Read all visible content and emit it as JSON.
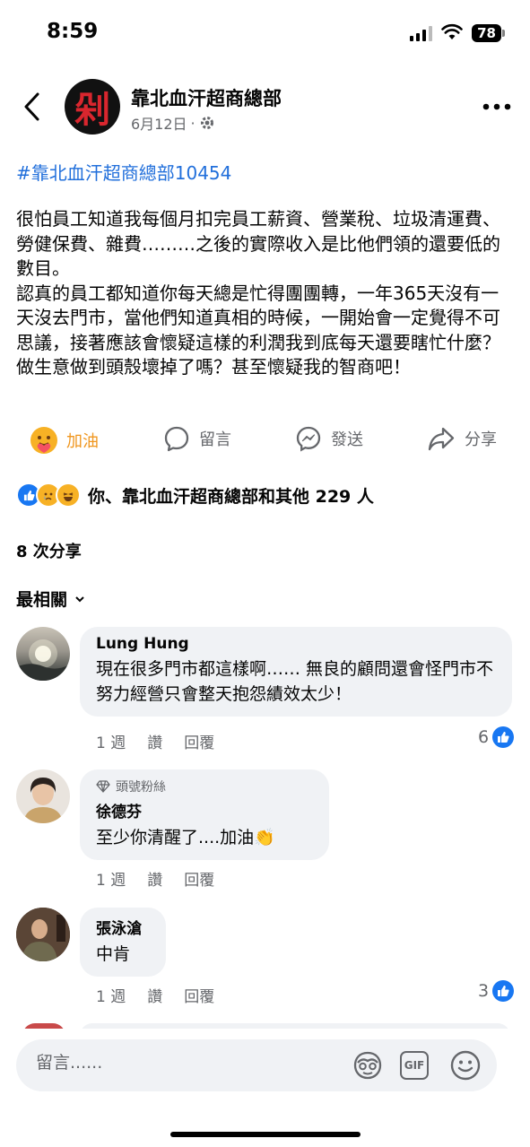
{
  "status_bar": {
    "time": "8:59",
    "battery": "78"
  },
  "post": {
    "page_name": "靠北血汗超商總部",
    "page_avatar_text": "剁",
    "date": "6月12日",
    "meta_sep": "·",
    "hashtag": "#靠北血汗超商總部10454",
    "body": "很怕員工知道我每個月扣完員工薪資、營業稅、垃圾清運費、勞健保費、雜費………之後的實際收入是比他們領的還要低的數目。\n認真的員工都知道你每天總是忙得團團轉，一年365天沒有一天沒去門市，當他們知道真相的時候，一開始會一定覺得不可思議，接著應該會懷疑這樣的利潤我到底每天還要瞎忙什麼？做生意做到頭殼壞掉了嗎？甚至懷疑我的智商吧！"
  },
  "actions": {
    "care": "加油",
    "comment": "留言",
    "send": "發送",
    "share": "分享"
  },
  "reactions": {
    "summary": "你、靠北血汗超商總部和其他 229 人"
  },
  "shares": "8 次分享",
  "sort_label": "最相關",
  "comments": [
    {
      "name": "Lung Hung",
      "badge": "",
      "text": "現在很多門市都這樣啊…… 無良的顧問還會怪門市不努力經營只會整天抱怨績效太少！",
      "time": "1 週",
      "like": "讚",
      "reply": "回覆",
      "likes": "6"
    },
    {
      "name": "徐德芬",
      "badge": "頭號粉絲",
      "text": "至少你清醒了....加油👏",
      "time": "1 週",
      "like": "讚",
      "reply": "回覆",
      "likes": ""
    },
    {
      "name": "張泳滄",
      "badge": "",
      "text": "中肯",
      "time": "1 週",
      "like": "讚",
      "reply": "回覆",
      "likes": "3"
    }
  ],
  "composer": {
    "placeholder": "留言......",
    "gif": "GIF"
  },
  "colors": {
    "link": "#216fdb",
    "like_blue": "#1877f2",
    "secondary_text": "#65676b",
    "bubble_bg": "#f0f2f5"
  }
}
